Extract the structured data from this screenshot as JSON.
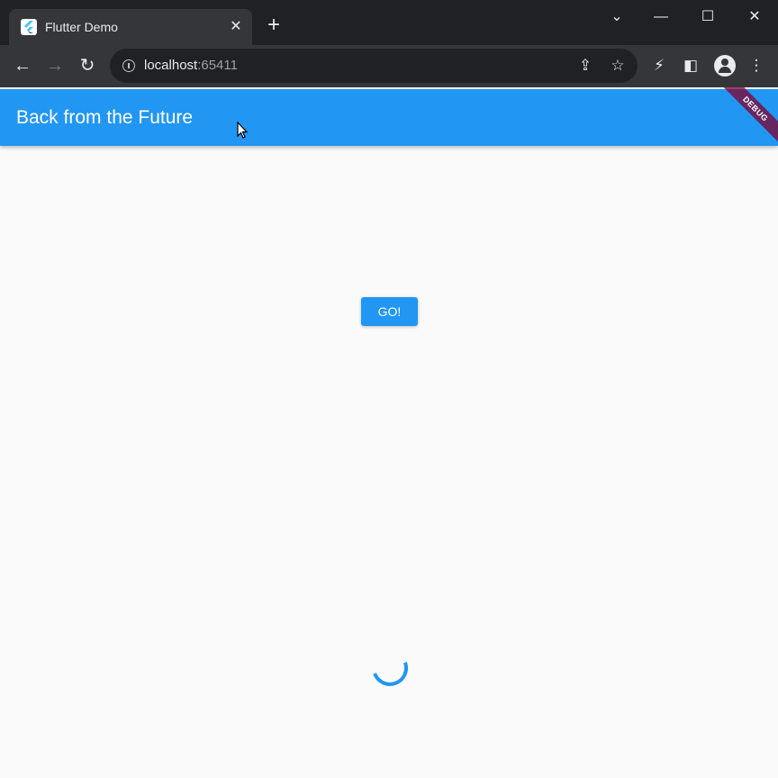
{
  "browser": {
    "tab": {
      "title": "Flutter Demo",
      "close": "✕"
    },
    "new_tab": "+",
    "window": {
      "minimize": "—",
      "maximize": "☐",
      "close": "✕",
      "tabs_menu": "⌄"
    },
    "toolbar": {
      "back": "←",
      "forward": "→",
      "reload": "↻",
      "url_host": "localhost",
      "url_port": ":65411",
      "share": "⇪",
      "bookmark": "☆",
      "extensions": "⚡",
      "side_panel": "◧",
      "menu": "⋮"
    }
  },
  "app": {
    "appbar": {
      "title": "Back from the Future",
      "color": "#2196f3"
    },
    "debug_banner": "DEBUG",
    "go_button": {
      "label": "GO!"
    },
    "spinner": {
      "color": "#2196f3"
    },
    "background": "#fafafa"
  }
}
